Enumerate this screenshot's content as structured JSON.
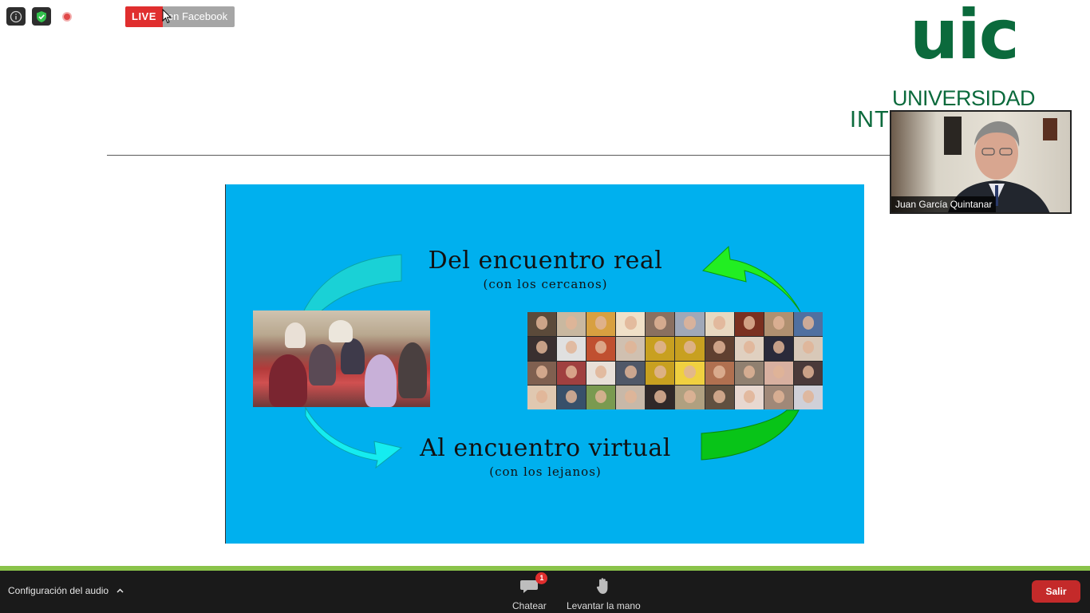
{
  "live": {
    "badge": "LIVE",
    "platform": "en Facebook"
  },
  "status_icons": [
    "info-icon",
    "shield-check-icon",
    "recording-icon"
  ],
  "logo": {
    "mark": "uic",
    "line1": "UNIVERSIDAD",
    "line2_visible": "INT"
  },
  "slide": {
    "title_top": "Del encuentro real",
    "subtitle_top": "(con los cercanos)",
    "title_bottom": "Al encuentro virtual",
    "subtitle_bottom": "(con los lejanos)",
    "colors": {
      "background": "#00b0ee",
      "arrow_cyan": "#22d3e0",
      "arrow_green": "#00e000"
    }
  },
  "video": {
    "participant_name": "Juan García Quintanar"
  },
  "toolbar": {
    "audio_settings_label": "Configuración del audio",
    "chat_label": "Chatear",
    "chat_badge": "1",
    "raise_hand_label": "Levantar la mano",
    "leave_label": "Salir",
    "accent_green": "#8ac34a",
    "leave_color": "#c42a2a"
  }
}
